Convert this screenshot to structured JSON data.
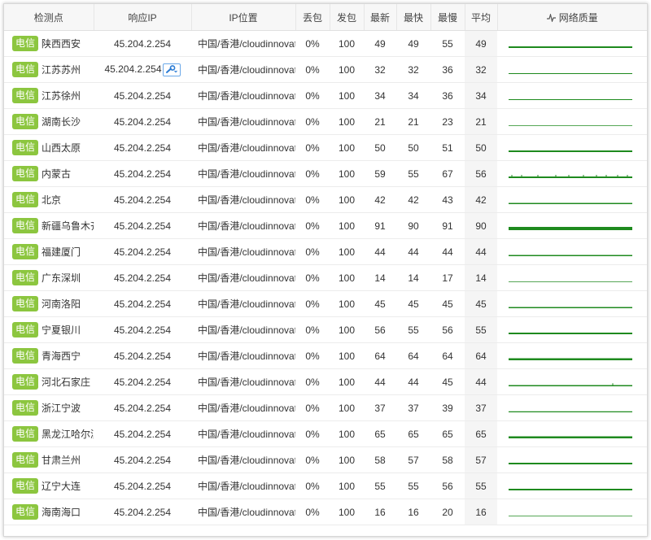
{
  "headers": {
    "node": "检测点",
    "ip": "响应IP",
    "location": "IP位置",
    "loss": "丢包",
    "sent": "发包",
    "latest": "最新",
    "fastest": "最快",
    "slowest": "最慢",
    "average": "平均",
    "quality": "网络质量"
  },
  "quality_icon": "pulse-icon",
  "accent_color": "#1e8a1e",
  "badge_color": "#8cc63f",
  "rows": [
    {
      "isp": "电信",
      "node": "陕西西安",
      "ip": "45.204.2.254",
      "location": "中国/香港/cloudinnovati",
      "loss": "0%",
      "sent": "100",
      "latest": "49",
      "fastest": "49",
      "slowest": "55",
      "average": "49",
      "line": "solid",
      "weight": 2
    },
    {
      "isp": "电信",
      "node": "江苏苏州",
      "ip": "45.204.2.254",
      "location": "中国/香港/cloudinnovati",
      "loss": "0%",
      "sent": "100",
      "latest": "32",
      "fastest": "32",
      "slowest": "36",
      "average": "32",
      "line": "solid",
      "weight": 1,
      "tool": "wrench-icon"
    },
    {
      "isp": "电信",
      "node": "江苏徐州",
      "ip": "45.204.2.254",
      "location": "中国/香港/cloudinnovati",
      "loss": "0%",
      "sent": "100",
      "latest": "34",
      "fastest": "34",
      "slowest": "36",
      "average": "34",
      "line": "solid",
      "weight": 1
    },
    {
      "isp": "电信",
      "node": "湖南长沙",
      "ip": "45.204.2.254",
      "location": "中国/香港/cloudinnovati",
      "loss": "0%",
      "sent": "100",
      "latest": "21",
      "fastest": "21",
      "slowest": "23",
      "average": "21",
      "line": "solid",
      "weight": 0.8
    },
    {
      "isp": "电信",
      "node": "山西太原",
      "ip": "45.204.2.254",
      "location": "中国/香港/cloudinnovati",
      "loss": "0%",
      "sent": "100",
      "latest": "50",
      "fastest": "50",
      "slowest": "51",
      "average": "50",
      "line": "solid",
      "weight": 2
    },
    {
      "isp": "电信",
      "node": "内蒙古",
      "ip": "45.204.2.254",
      "location": "中国/香港/cloudinnovati",
      "loss": "0%",
      "sent": "100",
      "latest": "59",
      "fastest": "55",
      "slowest": "67",
      "average": "56",
      "line": "spiky",
      "weight": 2
    },
    {
      "isp": "电信",
      "node": "北京",
      "ip": "45.204.2.254",
      "location": "中国/香港/cloudinnovati",
      "loss": "0%",
      "sent": "100",
      "latest": "42",
      "fastest": "42",
      "slowest": "43",
      "average": "42",
      "line": "solid",
      "weight": 1.5
    },
    {
      "isp": "电信",
      "node": "新疆乌鲁木齐",
      "ip": "45.204.2.254",
      "location": "中国/香港/cloudinnovati",
      "loss": "0%",
      "sent": "100",
      "latest": "91",
      "fastest": "90",
      "slowest": "91",
      "average": "90",
      "line": "solid",
      "weight": 4
    },
    {
      "isp": "电信",
      "node": "福建厦门",
      "ip": "45.204.2.254",
      "location": "中国/香港/cloudinnovati",
      "loss": "0%",
      "sent": "100",
      "latest": "44",
      "fastest": "44",
      "slowest": "44",
      "average": "44",
      "line": "solid",
      "weight": 1.5
    },
    {
      "isp": "电信",
      "node": "广东深圳",
      "ip": "45.204.2.254",
      "location": "中国/香港/cloudinnovati",
      "loss": "0%",
      "sent": "100",
      "latest": "14",
      "fastest": "14",
      "slowest": "17",
      "average": "14",
      "line": "solid",
      "weight": 0.8
    },
    {
      "isp": "电信",
      "node": "河南洛阳",
      "ip": "45.204.2.254",
      "location": "中国/香港/cloudinnovati",
      "loss": "0%",
      "sent": "100",
      "latest": "45",
      "fastest": "45",
      "slowest": "45",
      "average": "45",
      "line": "solid",
      "weight": 1.5
    },
    {
      "isp": "电信",
      "node": "宁夏银川",
      "ip": "45.204.2.254",
      "location": "中国/香港/cloudinnovati",
      "loss": "0%",
      "sent": "100",
      "latest": "56",
      "fastest": "55",
      "slowest": "56",
      "average": "55",
      "line": "solid",
      "weight": 2
    },
    {
      "isp": "电信",
      "node": "青海西宁",
      "ip": "45.204.2.254",
      "location": "中国/香港/cloudinnovati",
      "loss": "0%",
      "sent": "100",
      "latest": "64",
      "fastest": "64",
      "slowest": "64",
      "average": "64",
      "line": "solid",
      "weight": 2.5
    },
    {
      "isp": "电信",
      "node": "河北石家庄",
      "ip": "45.204.2.254",
      "location": "中国/香港/cloudinnovati",
      "loss": "0%",
      "sent": "100",
      "latest": "44",
      "fastest": "44",
      "slowest": "45",
      "average": "44",
      "line": "spiky-light",
      "weight": 1.5
    },
    {
      "isp": "电信",
      "node": "浙江宁波",
      "ip": "45.204.2.254",
      "location": "中国/香港/cloudinnovati",
      "loss": "0%",
      "sent": "100",
      "latest": "37",
      "fastest": "37",
      "slowest": "39",
      "average": "37",
      "line": "solid",
      "weight": 1.2
    },
    {
      "isp": "电信",
      "node": "黑龙江哈尔滨",
      "ip": "45.204.2.254",
      "location": "中国/香港/cloudinnovati",
      "loss": "0%",
      "sent": "100",
      "latest": "65",
      "fastest": "65",
      "slowest": "65",
      "average": "65",
      "line": "solid",
      "weight": 2.5
    },
    {
      "isp": "电信",
      "node": "甘肃兰州",
      "ip": "45.204.2.254",
      "location": "中国/香港/cloudinnovati",
      "loss": "0%",
      "sent": "100",
      "latest": "58",
      "fastest": "57",
      "slowest": "58",
      "average": "57",
      "line": "solid",
      "weight": 2
    },
    {
      "isp": "电信",
      "node": "辽宁大连",
      "ip": "45.204.2.254",
      "location": "中国/香港/cloudinnovati",
      "loss": "0%",
      "sent": "100",
      "latest": "55",
      "fastest": "55",
      "slowest": "56",
      "average": "55",
      "line": "solid",
      "weight": 2
    },
    {
      "isp": "电信",
      "node": "海南海口",
      "ip": "45.204.2.254",
      "location": "中国/香港/cloudinnovati",
      "loss": "0%",
      "sent": "100",
      "latest": "16",
      "fastest": "16",
      "slowest": "20",
      "average": "16",
      "line": "solid",
      "weight": 0.8
    }
  ]
}
